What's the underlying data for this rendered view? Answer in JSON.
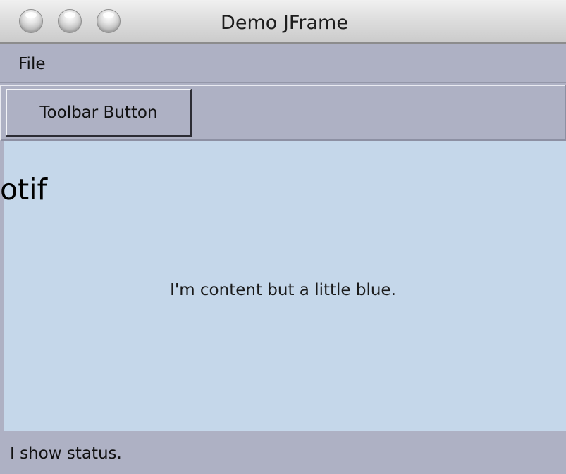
{
  "window": {
    "title": "Demo JFrame",
    "controls": [
      "close-icon",
      "minimize-icon",
      "zoom-icon"
    ]
  },
  "menubar": {
    "items": [
      {
        "label": "File"
      }
    ]
  },
  "toolbar": {
    "button_label": "Toolbar Button"
  },
  "content": {
    "overlay_label": "otif",
    "text": "I'm content but a little blue.",
    "background": "#c5d7ea"
  },
  "status": {
    "text": "I show status."
  },
  "colors": {
    "chrome": "#aeb1c4",
    "content": "#c5d7ea"
  }
}
